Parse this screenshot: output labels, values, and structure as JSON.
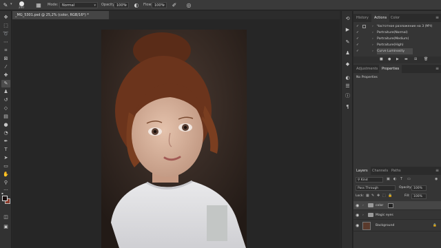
{
  "options_bar": {
    "brush_size": "200",
    "mode_label": "Mode:",
    "mode_value": "Normal",
    "opacity_label": "Opacity:",
    "opacity_value": "100%",
    "flow_label": "Flow:",
    "flow_value": "100%"
  },
  "document": {
    "tab_title": "_MG_5301.psd @ 25,2% (color, RGB/16*) *"
  },
  "panels": {
    "top_tabs": [
      "History",
      "Actions",
      "Color"
    ],
    "actions": [
      "Частотное разложение на 3 (МЧ)",
      "Portraiture(Normal)",
      "Portraiture(Medium)",
      "Portraiture(High)",
      "Curve Luminosity"
    ],
    "mid_tabs": [
      "Adjustments",
      "Properties"
    ],
    "properties_text": "No Properties",
    "layer_tabs": [
      "Layers",
      "Channels",
      "Paths"
    ],
    "kind_label": "Kind",
    "blend_mode": "Pass Through",
    "opacity_label": "Opacity:",
    "opacity_value": "100%",
    "lock_label": "Lock:",
    "fill_label": "Fill:",
    "fill_value": "100%",
    "layers": [
      {
        "name": "color"
      },
      {
        "name": "Magic eyes"
      },
      {
        "name": "Background"
      }
    ]
  },
  "colors": {
    "foreground": "#1a1010",
    "background": "#8a3a2a",
    "accent": "#4a4a4a"
  }
}
